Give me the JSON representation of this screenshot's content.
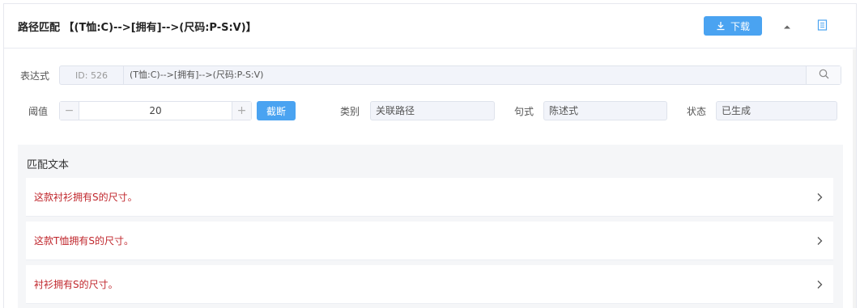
{
  "header": {
    "title": "路径匹配 【(T恤:C)-->[拥有]-->(尺码:P-S:V)】",
    "download_label": "下载",
    "download_icon": "download-icon",
    "collapse_icon": "caret-up-icon",
    "doc_icon": "document-icon"
  },
  "expression": {
    "label": "表达式",
    "id_text": "ID: 526",
    "value": "(T恤:C)-->[拥有]-->(尺码:P-S:V)",
    "search_icon": "search-icon"
  },
  "threshold": {
    "label": "阈值",
    "value": "20",
    "minus": "−",
    "plus": "+",
    "cut_label": "截断"
  },
  "fields": {
    "category_label": "类别",
    "category_value": "关联路径",
    "sentence_label": "句式",
    "sentence_value": "陈述式",
    "status_label": "状态",
    "status_value": "已生成"
  },
  "matches": {
    "title": "匹配文本",
    "items": [
      {
        "text": "这款衬衫拥有S的尺寸。"
      },
      {
        "text": "这款T恤拥有S的尺寸。"
      },
      {
        "text": "衬衫拥有S的尺寸。"
      }
    ]
  },
  "colors": {
    "primary": "#4aa3f1",
    "match_text": "#c0272d",
    "field_bg": "#f2f4fa",
    "section_bg": "#f5f6f8"
  }
}
